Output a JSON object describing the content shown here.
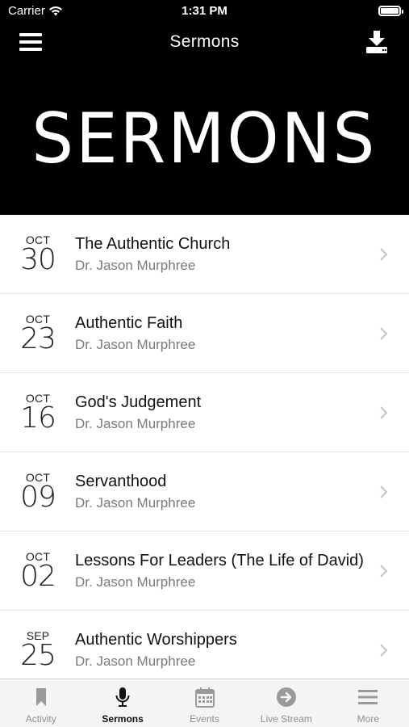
{
  "status_bar": {
    "carrier": "Carrier",
    "time": "1:31 PM"
  },
  "nav": {
    "title": "Sermons",
    "menu_icon": "hamburger-menu-icon",
    "download_icon": "download-icon"
  },
  "banner": {
    "text": "SERMONS"
  },
  "sermons": [
    {
      "month": "OCT",
      "day": "30",
      "title": "The Authentic Church",
      "speaker": "Dr. Jason Murphree"
    },
    {
      "month": "OCT",
      "day": "23",
      "title": "Authentic Faith",
      "speaker": "Dr. Jason Murphree"
    },
    {
      "month": "OCT",
      "day": "16",
      "title": "God's Judgement",
      "speaker": "Dr. Jason Murphree"
    },
    {
      "month": "OCT",
      "day": "09",
      "title": "Servanthood",
      "speaker": "Dr. Jason Murphree"
    },
    {
      "month": "OCT",
      "day": "02",
      "title": "Lessons For Leaders (The Life of David)",
      "speaker": "Dr. Jason Murphree"
    },
    {
      "month": "SEP",
      "day": "25",
      "title": "Authentic Worshippers",
      "speaker": "Dr. Jason Murphree"
    }
  ],
  "tabs": [
    {
      "label": "Activity",
      "icon": "bookmark-icon",
      "active": false
    },
    {
      "label": "Sermons",
      "icon": "microphone-icon",
      "active": true
    },
    {
      "label": "Events",
      "icon": "calendar-icon",
      "active": false
    },
    {
      "label": "Live Stream",
      "icon": "arrow-circle-icon",
      "active": false
    },
    {
      "label": "More",
      "icon": "more-lines-icon",
      "active": false
    }
  ],
  "colors": {
    "header_bg": "#000000",
    "tab_active": "#111111",
    "tab_inactive": "#8e8e8e",
    "speaker_text": "#7a7a7a"
  }
}
